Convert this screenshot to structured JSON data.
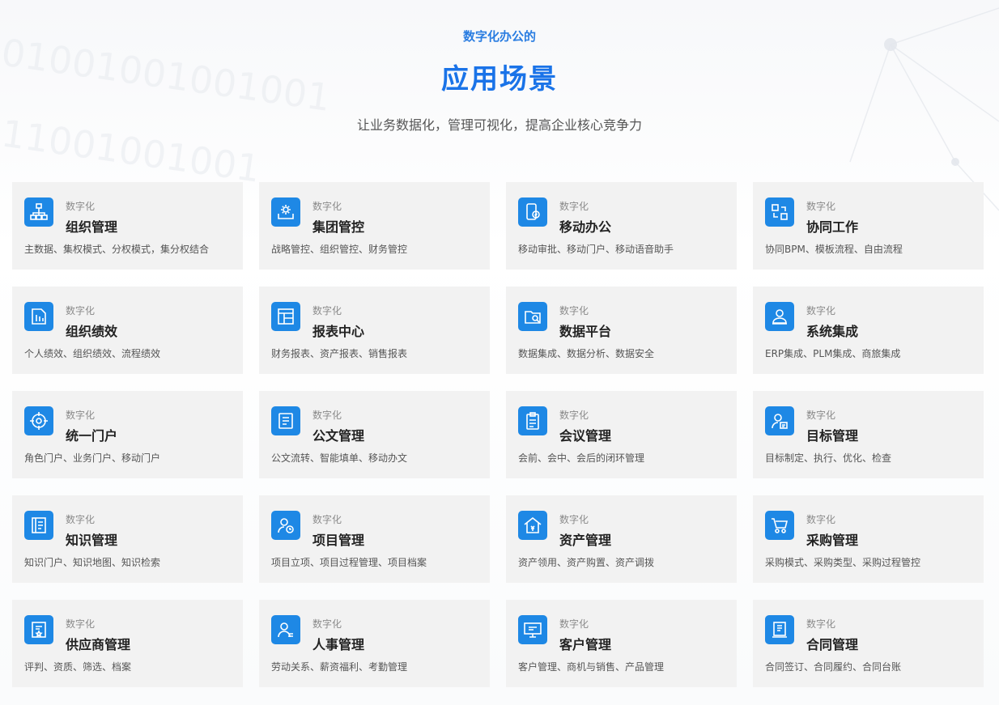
{
  "header": {
    "kicker": "数字化办公的",
    "title": "应用场景",
    "subtitle": "让业务数据化，管理可视化，提高企业核心竞争力"
  },
  "colors": {
    "accent": "#1e88e5",
    "card_bg": "#f2f2f2",
    "title": "#1a73e8"
  },
  "cards": [
    {
      "tag": "数字化",
      "name": "组织管理",
      "desc": "主数据、集权模式、分权模式，集分权结合",
      "icon": "org-chart-icon"
    },
    {
      "tag": "数字化",
      "name": "集团管控",
      "desc": "战略管控、组织管控、财务管控",
      "icon": "gear-box-icon"
    },
    {
      "tag": "数字化",
      "name": "移动办公",
      "desc": "移动审批、移动门户、移动语音助手",
      "icon": "mobile-icon"
    },
    {
      "tag": "数字化",
      "name": "协同工作",
      "desc": "协同BPM、模板流程、自由流程",
      "icon": "flow-icon"
    },
    {
      "tag": "数字化",
      "name": "组织绩效",
      "desc": "个人绩效、组织绩效、流程绩效",
      "icon": "performance-doc-icon"
    },
    {
      "tag": "数字化",
      "name": "报表中心",
      "desc": "财务报表、资产报表、销售报表",
      "icon": "report-icon"
    },
    {
      "tag": "数字化",
      "name": "数据平台",
      "desc": "数据集成、数据分析、数据安全",
      "icon": "data-folder-icon"
    },
    {
      "tag": "数字化",
      "name": "系统集成",
      "desc": "ERP集成、PLM集成、商旅集成",
      "icon": "integration-icon"
    },
    {
      "tag": "数字化",
      "name": "统一门户",
      "desc": "角色门户、业务门户、移动门户",
      "icon": "target-icon"
    },
    {
      "tag": "数字化",
      "name": "公文管理",
      "desc": "公文流转、智能填单、移动办文",
      "icon": "document-icon"
    },
    {
      "tag": "数字化",
      "name": "会议管理",
      "desc": "会前、会中、会后的闭环管理",
      "icon": "clipboard-icon"
    },
    {
      "tag": "数字化",
      "name": "目标管理",
      "desc": "目标制定、执行、优化、检查",
      "icon": "user-card-icon"
    },
    {
      "tag": "数字化",
      "name": "知识管理",
      "desc": "知识门户、知识地图、知识检索",
      "icon": "book-icon"
    },
    {
      "tag": "数字化",
      "name": "项目管理",
      "desc": "项目立项、项目过程管理、项目档案",
      "icon": "project-icon"
    },
    {
      "tag": "数字化",
      "name": "资产管理",
      "desc": "资产领用、资产购置、资产调拨",
      "icon": "asset-house-icon"
    },
    {
      "tag": "数字化",
      "name": "采购管理",
      "desc": "采购模式、采购类型、采购过程管控",
      "icon": "cart-icon"
    },
    {
      "tag": "数字化",
      "name": "供应商管理",
      "desc": "评判、资质、筛选、档案",
      "icon": "certificate-icon"
    },
    {
      "tag": "数字化",
      "name": "人事管理",
      "desc": "劳动关系、薪资福利、考勤管理",
      "icon": "person-icon"
    },
    {
      "tag": "数字化",
      "name": "客户管理",
      "desc": "客户管理、商机与销售、产品管理",
      "icon": "monitor-icon"
    },
    {
      "tag": "数字化",
      "name": "合同管理",
      "desc": "合同签订、合同履约、合同台账",
      "icon": "contract-icon"
    }
  ]
}
